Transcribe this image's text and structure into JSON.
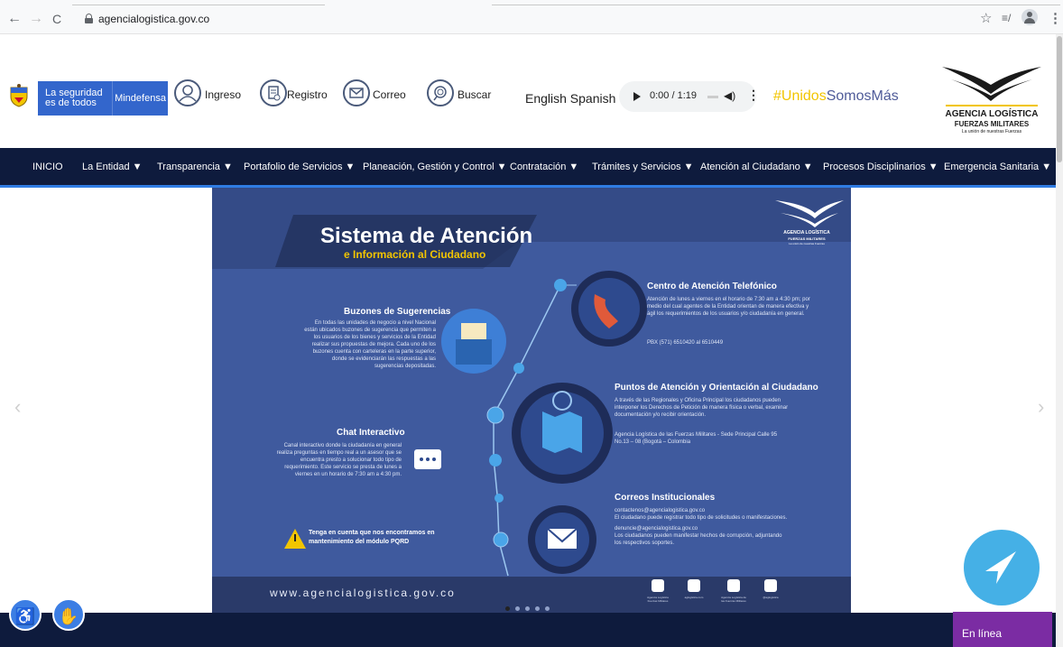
{
  "browser": {
    "url": "agencialogistica.gov.co",
    "back": "←",
    "forward": "→",
    "reload": "C",
    "star": "☆",
    "reading_list": "≡/",
    "menu": "⋮"
  },
  "header": {
    "gov_line1": "La seguridad",
    "gov_line2": "es de todos",
    "mindefensa": "Mindefensa",
    "links": [
      {
        "label": "Ingreso",
        "icon": "user-icon"
      },
      {
        "label": "Registro",
        "icon": "registry-icon"
      },
      {
        "label": "Correo",
        "icon": "mail-icon"
      },
      {
        "label": "Buscar",
        "icon": "search-icon"
      }
    ],
    "languages": "English Spanish",
    "audio": {
      "time": "0:00 / 1:19",
      "play": "play-icon",
      "volume": "volume-icon"
    },
    "hashtag_yellow": "#Unidos",
    "hashtag_blue": "SomosMás",
    "logo": {
      "line1": "AGENCIA LOGÍSTICA",
      "line2": "FUERZAS MILITARES",
      "line3": "La unión de nuestras Fuerzas"
    },
    "colors": {
      "gov_blue": "#3366cc",
      "hashtag_yellow": "#f2c500",
      "hashtag_blue": "#4f5b99"
    }
  },
  "nav": {
    "items": [
      {
        "label": "INICIO"
      },
      {
        "label": "La Entidad ▼"
      },
      {
        "label": "Transparencia ▼"
      },
      {
        "label": "Portafolio de Servicios ▼"
      },
      {
        "label": "Planeación, Gestión y Control ▼"
      },
      {
        "label": "Contratación ▼"
      },
      {
        "label": "Trámites y Servicios ▼"
      },
      {
        "label": "Atención al Ciudadano ▼"
      },
      {
        "label": "Procesos Disciplinarios ▼"
      },
      {
        "label": "Emergencia Sanitaria ▼"
      }
    ],
    "color": "#0e1b3d",
    "accent": "#2f7ce3"
  },
  "carousel": {
    "prev": "‹",
    "next": "›",
    "slide_count": 5,
    "active_slide": 1,
    "banner": {
      "title": "Sistema de Atención",
      "subtitle": "e Información al Ciudadano",
      "logo_line1": "AGENCIA LOGÍSTICA",
      "logo_line2": "FUERZAS MILITARES",
      "logo_line3": "La unión de nuestras Fuerzas",
      "sections": {
        "buzones": {
          "title": "Buzones de Sugerencias",
          "text": "En todas las unidades de negocio a nivel Nacional están ubicados buzones de sugerencia que permiten a los usuarios de los bienes y servicios de la Entidad realizar sus propuestas de mejora. Cada uno de los buzones cuenta con carteleras en la parte superior, donde se evidenciarán las respuestas a las sugerencias depositadas."
        },
        "telefonico": {
          "title": "Centro de Atención Telefónico",
          "text": "Atención de lunes a viernes en el horario de 7:30 am a 4:30 pm; por medio del cual agentes de la Entidad orientan de manera efectiva y ágil los requerimientos de los usuarios y/o ciudadanía en general.",
          "phone": "PBX (571) 6510420 al 6510449"
        },
        "puntos": {
          "title": "Puntos de Atención y Orientación al Ciudadano",
          "text": "A través de las Regionales y Oficina Principal los ciudadanos pueden interponer los Derechos de Petición de manera física o verbal, examinar documentación y/o recibir orientación.",
          "address": "Agencia Logística de las Fuerzas Militares - Sede Principal Calle 95 No.13 – 08 (Bogotá – Colombia"
        },
        "chat": {
          "title": "Chat Interactivo",
          "text": "Canal interactivo donde la ciudadanía en general realiza preguntas en tiempo real a un asesor que se encuentra presto a solucionar todo tipo de requerimiento. Este servicio se presta de lunes a viernes en un horario de 7:30 am a 4:30 pm."
        },
        "correos": {
          "title": "Correos Institucionales",
          "line1": "contactenos@agencialogistica.gov.co",
          "line2": "El ciudadano puede registrar todo tipo de solicitudes o manifestaciones.",
          "line3": "denuncie@agencialogistica.gov.co",
          "line4": "Los ciudadanos pueden manifestar hechos de corrupción, adjuntando los respectivos soportes."
        }
      },
      "warning": "Tenga en cuenta que nos encontramos en mantenimiento del módulo PQRD",
      "footer_url": "www.agencialogistica.gov.co",
      "social": [
        {
          "icon": "twitter-icon",
          "label": "Agencia Logística Fuerzas Militares"
        },
        {
          "icon": "instagram-icon",
          "label": "aglogistica.com"
        },
        {
          "icon": "facebook-icon",
          "label": "Agencia Logística de las Fuerzas Militares"
        },
        {
          "icon": "location-icon",
          "label": "@aglogistica"
        }
      ]
    }
  },
  "footer": {
    "chat_status": "En línea",
    "accessibility_icon": "wheelchair-icon",
    "sign_language_icon": "hands-icon",
    "chat_fab_icon": "send-arrow-icon"
  }
}
